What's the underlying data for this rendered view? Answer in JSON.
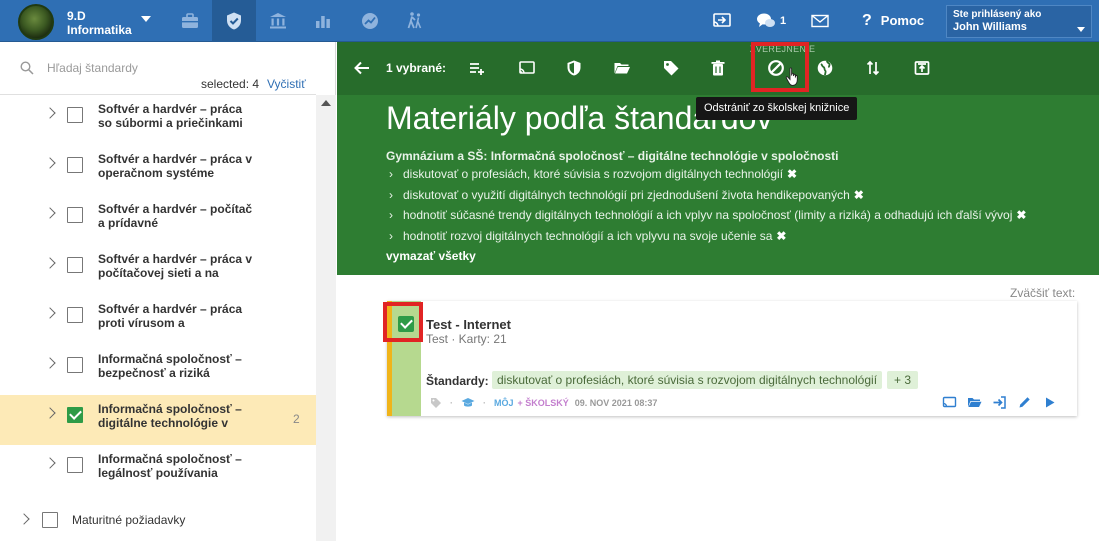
{
  "topbar": {
    "class_name": "9.D",
    "subject": "Informatika",
    "messages_count": "1",
    "help_label": "Pomoc",
    "user_label": "Ste prihlásený ako",
    "user_name": "John Williams",
    "bar_color": "#2f6fb4",
    "nav_icons": [
      "briefcase-icon",
      "shield-icon",
      "institution-icon",
      "bar-chart-icon",
      "graph-icon",
      "walking-icon"
    ]
  },
  "sidebar": {
    "search_placeholder": "Hľadaj štandardy",
    "selected_label": "selected: 4",
    "clear_label": "Vyčistiť",
    "items": [
      {
        "label": "Softvér a hardvér – práca so súbormi a priečinkami",
        "checked": false,
        "count": ""
      },
      {
        "label": "Softvér a hardvér – práca v operačnom systéme",
        "checked": false,
        "count": ""
      },
      {
        "label": "Softvér a hardvér – počítač a prídavné",
        "checked": false,
        "count": ""
      },
      {
        "label": "Softvér a hardvér – práca v počítačovej sieti a na",
        "checked": false,
        "count": ""
      },
      {
        "label": "Softvér a hardvér – práca proti vírusom a",
        "checked": false,
        "count": ""
      },
      {
        "label": "Informačná spoločnosť – bezpečnosť a riziká",
        "checked": false,
        "count": ""
      },
      {
        "label": "Informačná spoločnosť – digitálne technológie v",
        "checked": true,
        "count": "2"
      },
      {
        "label": "Informačná spoločnosť – legálnosť používania",
        "checked": false,
        "count": ""
      }
    ],
    "root_item": {
      "label": "Maturitné požiadavky",
      "checked": false
    }
  },
  "action_bar": {
    "selected_text": "1 vybrané:",
    "section_label": "ZVEREJNENIE",
    "tooltip": "Odstrániť zo školskej knižnice",
    "icons": [
      "back-arrow-icon",
      "add-to-list-icon",
      "cast-icon",
      "shield-icon",
      "folder-open-icon",
      "tag-icon",
      "trash-icon",
      "block-icon",
      "globe-icon",
      "sort-icon",
      "export-icon"
    ]
  },
  "header": {
    "title": "Materiály podľa štandardov",
    "standards_heading": "Gymnázium a SŠ: Informačná spoločnosť – digitálne technológie v spoločnosti",
    "standards": [
      "diskutovať o profesiách, ktoré súvisia s rozvojom digitálnych technológií",
      "diskutovať o využití digitálnych technológií pri zjednodušení života hendikepovaných",
      "hodnotiť súčasné trendy digitálnych technológií a ich vplyv na spoločnosť (limity a riziká) a odhadujú ich ďalší vývoj",
      "hodnotiť rozvoj digitálnych technológií a ich vplyvu na svoje učenie sa"
    ],
    "remove_mark": "✖",
    "clear_all": "vymazať všetky",
    "color": "#2e7d32"
  },
  "content": {
    "zoom_label": "Zväčšiť text:",
    "card": {
      "title": "Test - Internet",
      "subtitle": "Test · Karty: 21",
      "standards_label": "Štandardy:",
      "standard_chip": "diskutovať o profesiách, ktoré súvisia s rozvojom digitálnych technológií",
      "more_chip": "+ 3",
      "owner": "MÔJ",
      "school": "+ ŠKOLSKÝ",
      "date": "09. NOV 2021 08:37",
      "checked": true
    }
  }
}
